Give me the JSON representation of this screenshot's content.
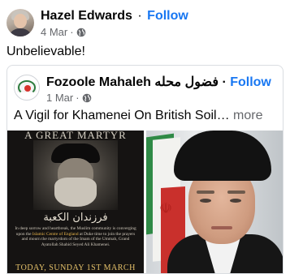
{
  "post": {
    "author": "Hazel Edwards",
    "separator": "·",
    "follow_label": "Follow",
    "date": "4 Mar",
    "meta_separator": "·",
    "privacy_icon": "globe-icon",
    "text": "Unbelievable!"
  },
  "shared_post": {
    "author": "Fozoole Mahaleh فضول محله",
    "separator": "·",
    "follow_label": "Follow",
    "date": "1 Mar",
    "meta_separator": "·",
    "privacy_icon": "globe-icon",
    "text": "A Vigil for Khamenei On British Soil…",
    "see_more_label": " more"
  },
  "poster": {
    "title": "A GREAT MARTYR",
    "calligraphy": "فرزندان الكعبة",
    "body_before": "In deep sorrow and heartbreak, the Muslim community is converging upon the ",
    "body_highlight": "Islamic Centre of England",
    "body_after": " at Duke time to join the prayers and mourn the martyrdom of the Imam of the Ummah, Grand Ayatollah Shahid Seyed Ali Khamenei.",
    "date": "TODAY, SUNDAY 1ST MARCH"
  },
  "colors": {
    "accent": "#1877f2",
    "secondary_text": "#65676b",
    "poster_highlight": "#e8b64c"
  }
}
